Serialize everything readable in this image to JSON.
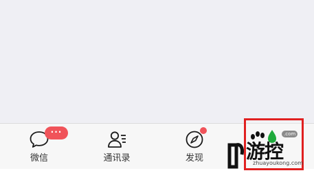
{
  "tab_bar": {
    "tabs": [
      {
        "label": "微信",
        "icon": "chat-bubble-icon",
        "badge": "···"
      },
      {
        "label": "通讯录",
        "icon": "contacts-icon"
      },
      {
        "label": "发现",
        "icon": "compass-icon",
        "dot_badge": true
      },
      {
        "label": "",
        "icon": "person-icon"
      }
    ]
  },
  "watermark": {
    "brand": "游控",
    "domain": "zhuayoukong.com",
    "com_badge": ".com",
    "accent_color": "#e02020"
  },
  "colors": {
    "badge": "#f0535a",
    "tab_bar_bg": "#f7f7f7",
    "content_bg": "#efeff4"
  }
}
